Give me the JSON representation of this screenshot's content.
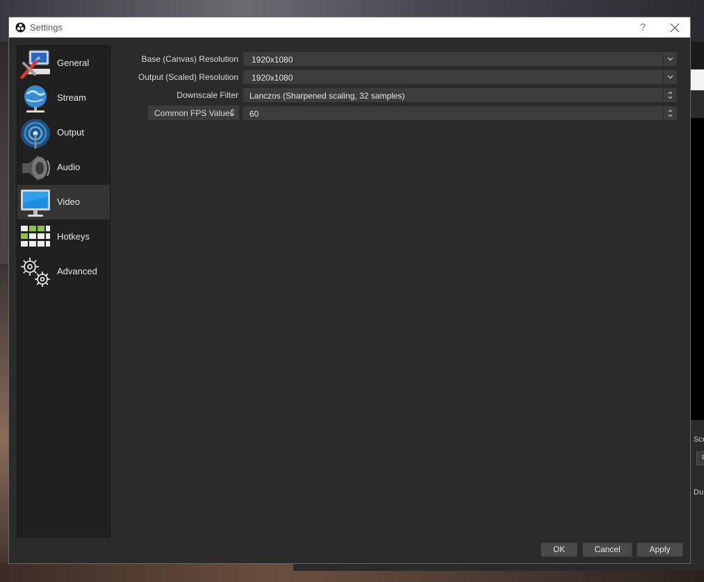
{
  "window": {
    "title": "Settings",
    "help_glyph": "?",
    "close_glyph": "✕"
  },
  "sidebar": {
    "items": [
      {
        "label": "General",
        "icon": "general-icon"
      },
      {
        "label": "Stream",
        "icon": "stream-icon"
      },
      {
        "label": "Output",
        "icon": "output-icon"
      },
      {
        "label": "Audio",
        "icon": "audio-icon"
      },
      {
        "label": "Video",
        "icon": "video-icon",
        "selected": true
      },
      {
        "label": "Hotkeys",
        "icon": "hotkeys-icon"
      },
      {
        "label": "Advanced",
        "icon": "advanced-icon"
      }
    ]
  },
  "video": {
    "base_resolution": {
      "label": "Base (Canvas) Resolution",
      "value": "1920x1080"
    },
    "output_resolution": {
      "label": "Output (Scaled) Resolution",
      "value": "1920x1080"
    },
    "downscale_filter": {
      "label": "Downscale Filter",
      "value": "Lanczos (Sharpened scaling, 32 samples)"
    },
    "fps": {
      "mode_label": "Common FPS Values",
      "value": "60"
    }
  },
  "buttons": {
    "ok": "OK",
    "cancel": "Cancel",
    "apply": "Apply"
  },
  "background_window": {
    "label_scene": "Sce",
    "label_du": "Du",
    "box_text": "F"
  },
  "colors": {
    "window_bg": "#2b2b2b",
    "sidebar_bg": "#202020",
    "selected_item": "#343434",
    "field_bg": "#3c3c3c",
    "button_bg": "#4a4a4a"
  }
}
